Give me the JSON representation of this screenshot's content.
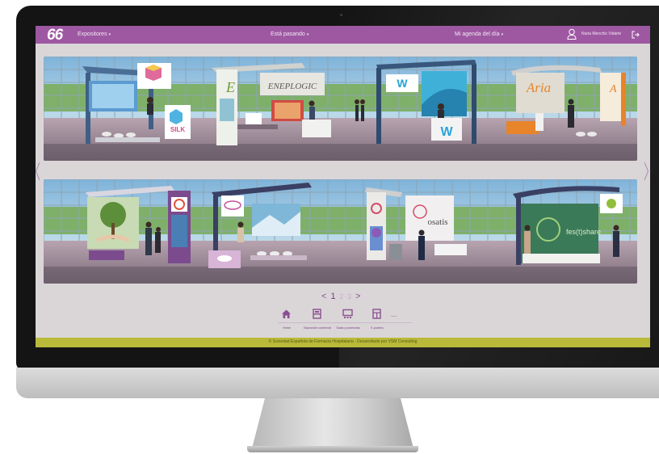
{
  "colors": {
    "brand_purple": "#9e58a2",
    "footer_olive": "#b9b93a",
    "screen_bg": "#dad6d8",
    "accent_text": "#7a3a82"
  },
  "topbar": {
    "logo": "66",
    "exhibitors_menu": "Expositores",
    "happening_menu": "Está pasando",
    "agenda_menu": "Mi agenda del día",
    "user_name": "Nuria Menchic Vidarte",
    "user_icon": "user-icon",
    "logout_icon": "logout-icon"
  },
  "stands": {
    "row1": [
      {
        "brand": "SILK"
      },
      {
        "brand": "ENEPLOGIC"
      },
      {
        "brand": "W"
      },
      {
        "brand": "Aria"
      }
    ],
    "row2": [
      {
        "brand": ""
      },
      {
        "brand": ""
      },
      {
        "brand": "osatis"
      },
      {
        "brand": "fes(t)share"
      }
    ]
  },
  "pagination": {
    "prev": "<",
    "pages": [
      "1",
      "2",
      "3"
    ],
    "current": "1",
    "next": ">"
  },
  "quick_nav": [
    {
      "icon": "home-icon",
      "label": "Home"
    },
    {
      "icon": "exhibition-icon",
      "label": "Exposición comercial"
    },
    {
      "icon": "rooms-icon",
      "label": "Salas y ponencias"
    },
    {
      "icon": "eposter-icon",
      "label": "E-posters"
    }
  ],
  "quick_nav_more": "...",
  "footer": {
    "text": "© Sociedad Española de Farmacia Hospitalaria · Desarrollado por VSM Consulting"
  }
}
